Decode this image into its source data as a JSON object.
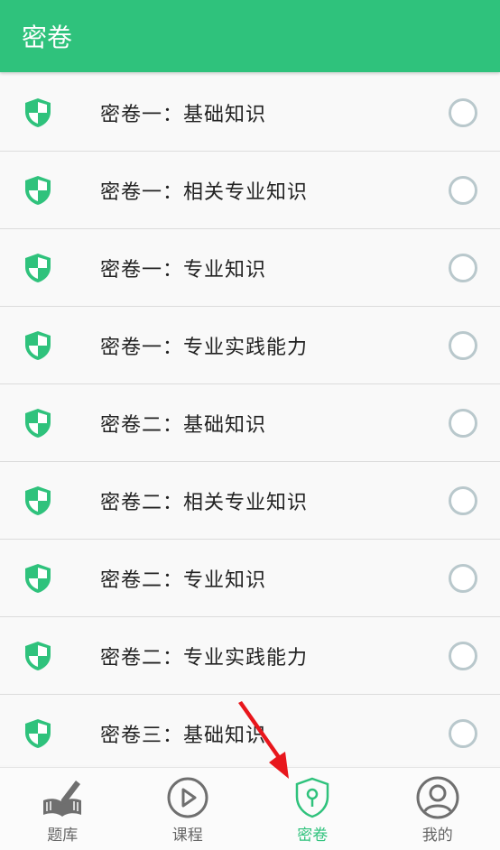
{
  "header": {
    "title": "密卷"
  },
  "colors": {
    "accent": "#2fc27c",
    "radio_border": "#b9c8cc",
    "annotation_arrow": "#e8161c"
  },
  "papers": [
    {
      "label": "密卷一：基础知识",
      "icon": "shield-icon"
    },
    {
      "label": "密卷一：相关专业知识",
      "icon": "shield-icon"
    },
    {
      "label": "密卷一：专业知识",
      "icon": "shield-icon"
    },
    {
      "label": "密卷一：专业实践能力",
      "icon": "shield-icon"
    },
    {
      "label": "密卷二：基础知识",
      "icon": "shield-icon"
    },
    {
      "label": "密卷二：相关专业知识",
      "icon": "shield-icon"
    },
    {
      "label": "密卷二：专业知识",
      "icon": "shield-icon"
    },
    {
      "label": "密卷二：专业实践能力",
      "icon": "shield-icon"
    },
    {
      "label": "密卷三：基础知识",
      "icon": "shield-icon"
    }
  ],
  "tabs": [
    {
      "label": "题库",
      "icon": "book-pencil-icon",
      "active": false
    },
    {
      "label": "课程",
      "icon": "play-circle-icon",
      "active": false
    },
    {
      "label": "密卷",
      "icon": "shield-lock-icon",
      "active": true
    },
    {
      "label": "我的",
      "icon": "user-circle-icon",
      "active": false
    }
  ]
}
